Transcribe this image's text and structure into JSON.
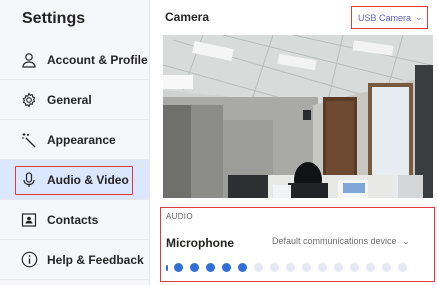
{
  "sidebar": {
    "title": "Settings",
    "items": [
      {
        "label": "Account & Profile",
        "icon": "person-icon"
      },
      {
        "label": "General",
        "icon": "gear-icon"
      },
      {
        "label": "Appearance",
        "icon": "magic-wand-icon"
      },
      {
        "label": "Audio & Video",
        "icon": "microphone-icon",
        "active": true
      },
      {
        "label": "Contacts",
        "icon": "contact-card-icon"
      },
      {
        "label": "Help & Feedback",
        "icon": "info-icon"
      }
    ]
  },
  "camera": {
    "title": "Camera",
    "device": "USB Camera"
  },
  "audio": {
    "heading": "AUDIO",
    "mic_label": "Microphone",
    "mic_device": "Default communications device",
    "level_active_dots": 5,
    "level_total_dots": 15
  },
  "colors": {
    "accent": "#5b5fc7",
    "highlight_border": "#e0393e",
    "active_bg": "#dbe6ff",
    "level_on": "#2f6fd6"
  }
}
